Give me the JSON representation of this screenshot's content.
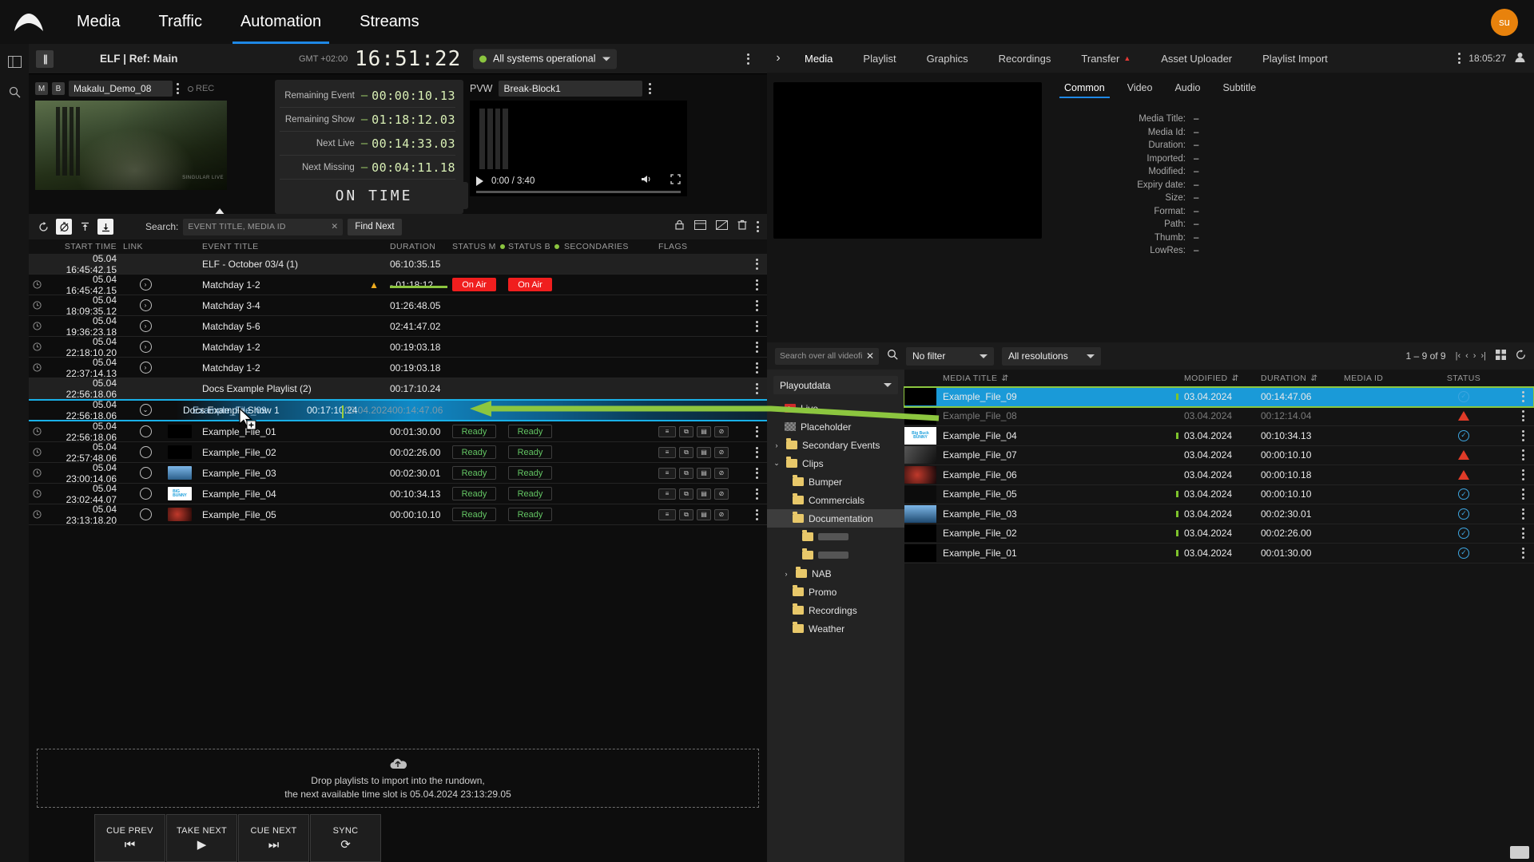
{
  "topnav": {
    "logo": "mountain-logo",
    "items": [
      {
        "label": "Media",
        "active": false
      },
      {
        "label": "Traffic",
        "active": false
      },
      {
        "label": "Automation",
        "active": true
      },
      {
        "label": "Streams",
        "active": false
      }
    ],
    "avatar_initials": "su"
  },
  "channel_bar": {
    "channel_name": "ELF | Ref: Main",
    "gmt_label": "GMT +02:00",
    "clock": "16:51:22",
    "system_status": "All systems operational"
  },
  "monitor": {
    "badge_m": "M",
    "badge_b": "B",
    "program_source": "Makalu_Demo_08",
    "rec_label": "REC",
    "thumb_watermark": "SINGULAR LIVE",
    "pvw_label": "PVW",
    "pvw_source": "Break-Block1",
    "video_time": "0:00 / 3:40",
    "on_time_label": "ON TIME",
    "timers": [
      {
        "label": "Remaining Event",
        "sign": "–",
        "value": "00:00:10.13"
      },
      {
        "label": "Remaining Show",
        "sign": "–",
        "value": "01:18:12.03"
      },
      {
        "label": "Next Live",
        "sign": "–",
        "value": "00:14:33.03"
      },
      {
        "label": "Next Missing",
        "sign": "–",
        "value": "00:04:11.18"
      }
    ]
  },
  "search_toolbar": {
    "icons": [
      "refresh-icon",
      "no-timer-icon",
      "jump-top-icon",
      "jump-bottom-icon"
    ],
    "label": "Search:",
    "placeholder": "EVENT TITLE, MEDIA ID",
    "value": "",
    "clear_label": "✕",
    "find_next_label": "Find Next",
    "right_icons": [
      "lock-icon",
      "card-icon",
      "no-card-icon",
      "delete-icon",
      "kebab-icon"
    ]
  },
  "rundown": {
    "columns": [
      "START TIME",
      "LINK",
      "EVENT TITLE",
      "DURATION",
      "STATUS M",
      "STATUS B",
      "SECONDARIES",
      "FLAGS"
    ],
    "rows": [
      {
        "type": "group",
        "clock": false,
        "start": "05.04  16:45:42.15",
        "link": false,
        "title": "ELF - October 03/4 (1)",
        "duration": "06:10:35.15",
        "status_m": "",
        "status_b": "",
        "thumb": "none",
        "flags": []
      },
      {
        "type": "event",
        "clock": true,
        "start": "05.04  16:45:42.15",
        "link": true,
        "title": "Matchday 1-2",
        "warn": true,
        "duration": "- 01:18:12",
        "progress": true,
        "status_m": "On Air",
        "status_b": "On Air",
        "thumb": "none",
        "flags": []
      },
      {
        "type": "event",
        "clock": true,
        "start": "05.04  18:09:35.12",
        "link": true,
        "title": "Matchday 3-4",
        "duration": "01:26:48.05",
        "status_m": "",
        "status_b": "",
        "thumb": "none",
        "flags": []
      },
      {
        "type": "event",
        "clock": true,
        "start": "05.04  19:36:23.18",
        "link": true,
        "title": "Matchday 5-6",
        "duration": "02:41:47.02",
        "status_m": "",
        "status_b": "",
        "thumb": "none",
        "flags": []
      },
      {
        "type": "event",
        "clock": true,
        "start": "05.04  22:18:10.20",
        "link": true,
        "title": "Matchday 1-2",
        "duration": "00:19:03.18",
        "status_m": "",
        "status_b": "",
        "thumb": "none",
        "flags": []
      },
      {
        "type": "event",
        "clock": true,
        "start": "05.04  22:37:14.13",
        "link": true,
        "title": "Matchday 1-2",
        "duration": "00:19:03.18",
        "status_m": "",
        "status_b": "",
        "thumb": "none",
        "flags": []
      },
      {
        "type": "group",
        "clock": false,
        "start": "05.04  22:56:18.06",
        "link": false,
        "title": "Docs Example Playlist (2)",
        "duration": "00:17:10.24",
        "status_m": "",
        "status_b": "",
        "thumb": "none",
        "flags": []
      },
      {
        "type": "drag",
        "clock": false,
        "start": "05.04  22:56:18.06",
        "link": true,
        "title": "Docs Example Show 1",
        "duration": "00:17:10.24",
        "ghost_title": "Example_File_09",
        "ghost_date": "03.04.2024",
        "ghost_length": "00:14:47.06"
      },
      {
        "type": "clip",
        "clock": true,
        "start": "05.04  22:56:18.06",
        "link": true,
        "title": "Example_File_01",
        "duration": "00:01:30.00",
        "status_m": "Ready",
        "status_b": "Ready",
        "thumb": "black",
        "flags": [
          "list-icon",
          "copy-icon",
          "layers-icon",
          "nogfx-icon"
        ]
      },
      {
        "type": "clip",
        "clock": true,
        "start": "05.04  22:57:48.06",
        "link": true,
        "title": "Example_File_02",
        "duration": "00:02:26.00",
        "status_m": "Ready",
        "status_b": "Ready",
        "thumb": "black",
        "flags": [
          "list-icon",
          "copy-icon",
          "layers-icon",
          "nogfx-icon"
        ]
      },
      {
        "type": "clip",
        "clock": true,
        "start": "05.04  23:00:14.06",
        "link": true,
        "title": "Example_File_03",
        "duration": "00:02:30.01",
        "status_m": "Ready",
        "status_b": "Ready",
        "thumb": "sky",
        "flags": [
          "list-icon",
          "copy-icon",
          "layers-icon",
          "nogfx-icon"
        ]
      },
      {
        "type": "clip",
        "clock": true,
        "start": "05.04  23:02:44.07",
        "link": true,
        "title": "Example_File_04",
        "duration": "00:10:34.13",
        "status_m": "Ready",
        "status_b": "Ready",
        "thumb": "bunny",
        "flags": [
          "list-icon",
          "copy-icon",
          "layers-icon",
          "nogfx-icon"
        ]
      },
      {
        "type": "clip",
        "clock": true,
        "start": "05.04  23:13:18.20",
        "link": true,
        "title": "Example_File_05",
        "duration": "00:00:10.10",
        "status_m": "Ready",
        "status_b": "Ready",
        "thumb": "red",
        "flags": [
          "list-icon",
          "copy-icon",
          "layers-icon",
          "nogfx-icon"
        ]
      }
    ]
  },
  "dropzone": {
    "line1": "Drop playlists to import into the rundown,",
    "line2": "the next available time slot is 05.04.2024 23:13:29.05",
    "icon": "upload-cloud-icon"
  },
  "transport": [
    {
      "label": "CUE PREV",
      "icon": "skip-prev-icon"
    },
    {
      "label": "TAKE NEXT",
      "icon": "play-icon"
    },
    {
      "label": "CUE NEXT",
      "icon": "skip-next-icon"
    },
    {
      "label": "SYNC",
      "icon": "sync-icon"
    }
  ],
  "right_panel": {
    "tabs": [
      {
        "label": "Media",
        "active": true,
        "alert": false
      },
      {
        "label": "Playlist",
        "active": false,
        "alert": false
      },
      {
        "label": "Graphics",
        "active": false,
        "alert": false
      },
      {
        "label": "Recordings",
        "active": false,
        "alert": false
      },
      {
        "label": "Transfer",
        "active": false,
        "alert": true
      },
      {
        "label": "Asset Uploader",
        "active": false,
        "alert": false
      },
      {
        "label": "Playlist Import",
        "active": false,
        "alert": false
      }
    ],
    "time": "18:05:27",
    "metadata_tabs": [
      {
        "label": "Common",
        "active": true
      },
      {
        "label": "Video",
        "active": false
      },
      {
        "label": "Audio",
        "active": false
      },
      {
        "label": "Subtitle",
        "active": false
      }
    ],
    "metadata": [
      {
        "key": "Media Title:",
        "value": "–"
      },
      {
        "key": "Media Id:",
        "value": "–"
      },
      {
        "key": "Duration:",
        "value": "–"
      },
      {
        "key": "Imported:",
        "value": "–"
      },
      {
        "key": "Modified:",
        "value": "–"
      },
      {
        "key": "Expiry date:",
        "value": "–"
      },
      {
        "key": "Size:",
        "value": "–"
      },
      {
        "key": "Format:",
        "value": "–"
      },
      {
        "key": "Path:",
        "value": "–"
      },
      {
        "key": "Thumb:",
        "value": "–"
      },
      {
        "key": "LowRes:",
        "value": "–"
      }
    ]
  },
  "media_browser": {
    "search_placeholder": "Search over all videofi",
    "search_value": "",
    "filter_value": "No filter",
    "resolution_value": "All resolutions",
    "pagination": "1 – 9 of 9",
    "tree_root": "Playoutdata",
    "tree": [
      {
        "label": "Live",
        "icon": "live-icon",
        "depth": 1,
        "chevron": "",
        "selected": false
      },
      {
        "label": "Placeholder",
        "icon": "placeholder-icon",
        "depth": 1,
        "chevron": "",
        "selected": false
      },
      {
        "label": "Secondary Events",
        "icon": "folder-icon",
        "depth": 1,
        "chevron": "›",
        "selected": false
      },
      {
        "label": "Clips",
        "icon": "folder-icon",
        "depth": 1,
        "chevron": "⌄",
        "selected": false
      },
      {
        "label": "Bumper",
        "icon": "folder-icon",
        "depth": 2,
        "chevron": "",
        "selected": false
      },
      {
        "label": "Commercials",
        "icon": "folder-icon",
        "depth": 2,
        "chevron": "",
        "selected": false
      },
      {
        "label": "Documentation",
        "icon": "folder-icon",
        "depth": 2,
        "chevron": "",
        "selected": true
      },
      {
        "label": "",
        "icon": "folder-icon",
        "depth": 3,
        "chevron": "",
        "selected": false,
        "blurred": true
      },
      {
        "label": "",
        "icon": "folder-icon",
        "depth": 3,
        "chevron": "",
        "selected": false,
        "blurred": true
      },
      {
        "label": "NAB",
        "icon": "folder-icon",
        "depth": 2,
        "chevron": "›",
        "selected": false
      },
      {
        "label": "Promo",
        "icon": "folder-icon",
        "depth": 2,
        "chevron": "",
        "selected": false
      },
      {
        "label": "Recordings",
        "icon": "folder-icon",
        "depth": 2,
        "chevron": "",
        "selected": false
      },
      {
        "label": "Weather",
        "icon": "folder-icon",
        "depth": 2,
        "chevron": "",
        "selected": false
      }
    ],
    "columns": [
      "MEDIA TITLE",
      "MODIFIED",
      "DURATION",
      "MEDIA ID",
      "STATUS"
    ],
    "rows": [
      {
        "title": "Example_File_09",
        "modified": "03.04.2024",
        "duration": "00:14:47.06",
        "media_id": "",
        "status": "ok",
        "selected": true,
        "dragged": true,
        "tick": true,
        "thumb": "black"
      },
      {
        "title": "Example_File_08",
        "modified": "03.04.2024",
        "duration": "00:12:14.04",
        "media_id": "",
        "status": "warn",
        "selected": false,
        "dim": true,
        "tick": false,
        "thumb": "black"
      },
      {
        "title": "Example_File_04",
        "modified": "03.04.2024",
        "duration": "00:10:34.13",
        "media_id": "",
        "status": "ok",
        "selected": false,
        "tick": true,
        "thumb": "bunny"
      },
      {
        "title": "Example_File_07",
        "modified": "03.04.2024",
        "duration": "00:00:10.10",
        "media_id": "",
        "status": "warn",
        "selected": false,
        "tick": false,
        "thumb": "gray"
      },
      {
        "title": "Example_File_06",
        "modified": "03.04.2024",
        "duration": "00:00:10.18",
        "media_id": "",
        "status": "warn",
        "selected": false,
        "tick": false,
        "thumb": "red"
      },
      {
        "title": "Example_File_05",
        "modified": "03.04.2024",
        "duration": "00:00:10.10",
        "media_id": "",
        "status": "ok",
        "selected": false,
        "tick": true,
        "thumb": "dark"
      },
      {
        "title": "Example_File_03",
        "modified": "03.04.2024",
        "duration": "00:02:30.01",
        "media_id": "",
        "status": "ok",
        "selected": false,
        "tick": true,
        "thumb": "sky"
      },
      {
        "title": "Example_File_02",
        "modified": "03.04.2024",
        "duration": "00:02:26.00",
        "media_id": "",
        "status": "ok",
        "selected": false,
        "tick": true,
        "thumb": "black"
      },
      {
        "title": "Example_File_01",
        "modified": "03.04.2024",
        "duration": "00:01:30.00",
        "media_id": "",
        "status": "ok",
        "selected": false,
        "tick": true,
        "thumb": "black"
      }
    ]
  },
  "colors": {
    "accent_blue": "#1e88e5",
    "select_blue": "#1a9ad8",
    "annotation_green": "#8cc63f",
    "on_air_red": "#f01e1e",
    "ready_green": "#63c463",
    "status_ok": "#3ea6e0",
    "status_warn": "#e03b28",
    "avatar_orange": "#e8820c"
  }
}
